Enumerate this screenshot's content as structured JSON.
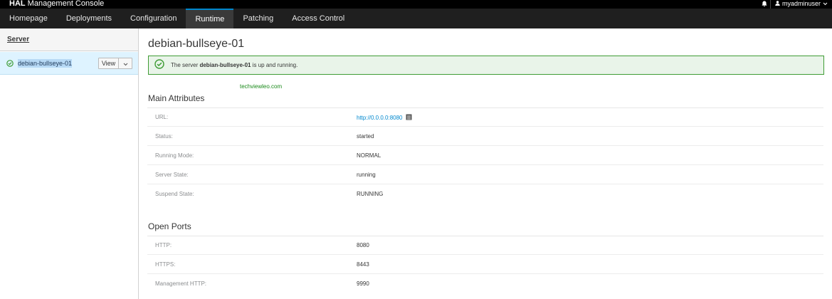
{
  "app": {
    "brand_bold": "HAL",
    "brand_rest": "Management Console"
  },
  "header": {
    "user": "myadminuser"
  },
  "nav": {
    "tabs": [
      {
        "label": "Homepage"
      },
      {
        "label": "Deployments"
      },
      {
        "label": "Configuration"
      },
      {
        "label": "Runtime",
        "active": true
      },
      {
        "label": "Patching"
      },
      {
        "label": "Access Control"
      }
    ]
  },
  "sidebar": {
    "title": "Server",
    "server": {
      "name": "debian-bullseye-01",
      "view_label": "View",
      "status": "ok"
    }
  },
  "main": {
    "title": "debian-bullseye-01",
    "alert": {
      "prefix": "The server",
      "server": "debian-bullseye-01",
      "suffix": "is up and running."
    },
    "watermark": "techviewleo.com",
    "main_attributes": {
      "title": "Main Attributes",
      "rows": [
        {
          "label": "URL:",
          "value": "http://0.0.0.0:8080",
          "link": true
        },
        {
          "label": "Status:",
          "value": "started"
        },
        {
          "label": "Running Mode:",
          "value": "NORMAL"
        },
        {
          "label": "Server State:",
          "value": "running"
        },
        {
          "label": "Suspend State:",
          "value": "RUNNING"
        }
      ]
    },
    "open_ports": {
      "title": "Open Ports",
      "rows": [
        {
          "label": "HTTP:",
          "value": "8080"
        },
        {
          "label": "HTTPS:",
          "value": "8443"
        },
        {
          "label": "Management HTTP:",
          "value": "9990"
        }
      ]
    }
  },
  "colors": {
    "accent": "#0088ce",
    "success": "#3f9c35",
    "selected": "#def3ff"
  }
}
